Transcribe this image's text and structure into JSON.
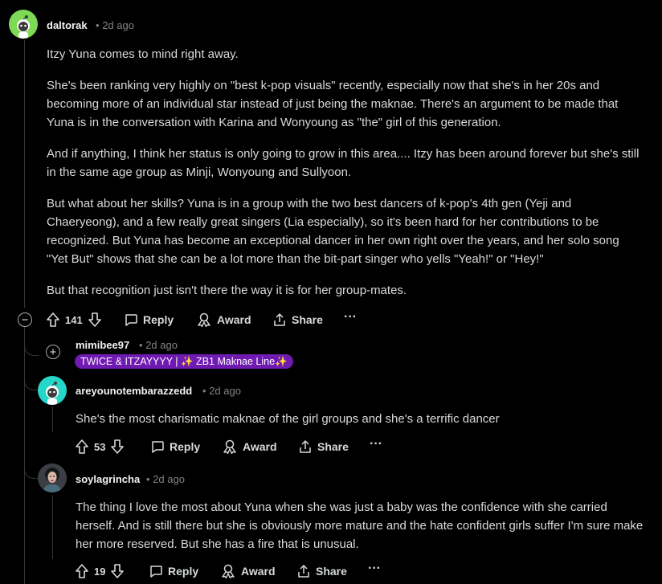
{
  "comments": [
    {
      "username": "daltorak",
      "time": "2d ago",
      "paragraphs": [
        "Itzy Yuna comes to mind right away.",
        "She's been ranking very highly on \"best k-pop visuals\" recently, especially now that she's in her 20s and becoming more of an individual star instead of just being the maknae. There's an argument to be made that Yuna is in the conversation with Karina and Wonyoung as \"the\" girl of this generation.",
        "And if anything, I think her status is only going to grow in this area.... Itzy has been around forever but she's still in the same age group as Minji, Wonyoung and Sullyoon.",
        "But what about her skills? Yuna is in a group with the two best dancers of k-pop's 4th gen (Yeji and Chaeryeong), and a few really great singers (Lia especially), so it's been hard for her contributions to be recognized. But Yuna has become an exceptional dancer in her own right over the years, and her solo song \"Yet But\" shows that she can be a lot more than the bit-part singer who yells \"Yeah!\" or \"Hey!\"",
        "But that recognition just isn't there the way it is for her group-mates."
      ],
      "score": "141"
    },
    {
      "username": "mimibee97",
      "time": "2d ago",
      "flair": "TWICE & ITZAYYYY | ✨ ZB1 Maknae Line✨"
    },
    {
      "username": "areyounotembarazzedd",
      "time": "2d ago",
      "paragraphs": [
        "She's the most charismatic maknae of the girl groups and she's a terrific dancer"
      ],
      "score": "53"
    },
    {
      "username": "soylagrincha",
      "time": "2d ago",
      "paragraphs": [
        "The thing I love the most about Yuna when she was just a baby was the confidence with she carried herself. And is still there but she is obviously more mature and the hate confident girls suffer I'm sure make her more reserved. But she has a fire that is unusual."
      ],
      "score": "19"
    }
  ],
  "actions": {
    "reply": "Reply",
    "award": "Award",
    "share": "Share",
    "more": "···"
  },
  "separator": "•",
  "colors": {
    "background": "#000000",
    "avatar_green": "#7ed957",
    "avatar_teal": "#26d7c8",
    "flair_purple": "#6f1ab1"
  }
}
